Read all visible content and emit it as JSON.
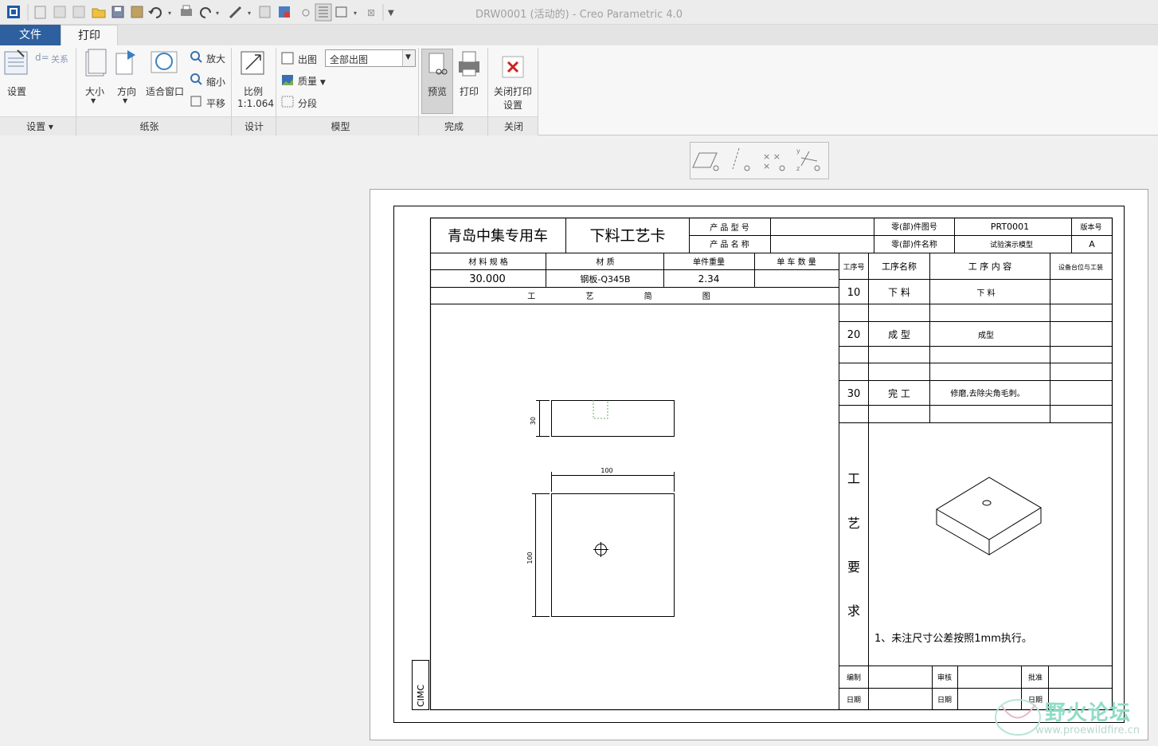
{
  "window": {
    "title": "DRW0001 (活动的) - Creo Parametric 4.0"
  },
  "tabs": {
    "file": "文件",
    "print": "打印"
  },
  "ribbon": {
    "settings": {
      "btn": "设置",
      "relations": "关系",
      "group": "设置"
    },
    "paper": {
      "size": "大小",
      "orient": "方向",
      "fit": "适合窗口",
      "zoom_in": "放大",
      "zoom_out": "缩小",
      "pan": "平移",
      "group": "纸张"
    },
    "design": {
      "scale_label": "比例",
      "scale_value": "1:1.064",
      "group": "设计"
    },
    "model": {
      "output": "出图",
      "output_select": "全部出图",
      "quality": "质量",
      "segment": "分段",
      "group": "模型"
    },
    "finish": {
      "preview": "预览",
      "print": "打印",
      "group": "完成"
    },
    "close": {
      "label1": "关闭打印",
      "label2": "设置",
      "group": "关闭"
    }
  },
  "drawing": {
    "company": "青岛中集专用车",
    "card_title": "下料工艺卡",
    "product_model_label": "产 品 型 号",
    "product_name_label": "产 品 名 称",
    "part_no_label": "零(部)件图号",
    "part_name_label": "零(部)件名称",
    "part_no": "PRT0001",
    "part_name": "试验演示模型",
    "version_label": "版本号",
    "version": "A",
    "mat_spec_label": "材 料 规 格",
    "material_label": "材    质",
    "unit_weight_label": "单件重量",
    "per_vehicle_label": "单 车 数 量",
    "mat_spec": "30.000",
    "material": "钢板-Q345B",
    "unit_weight": "2.34",
    "sketch_label": "工 艺 简 图",
    "ops_headers": {
      "no": "工序号",
      "name": "工序名称",
      "content": "工 序 内 容",
      "equipment": "设备台位与工装"
    },
    "ops": [
      {
        "no": "10",
        "name": "下 料",
        "content": "下 料"
      },
      {
        "no": "20",
        "name": "成 型",
        "content": "成型"
      },
      {
        "no": "30",
        "name": "完 工",
        "content": "修磨,去除尖角毛刺。"
      }
    ],
    "req_label": [
      "工",
      "艺",
      "要",
      "求"
    ],
    "req_text": "1、未注尺寸公差按照1mm执行。",
    "sign": {
      "edit": "编制",
      "review": "审核",
      "approve": "批准",
      "date": "日期"
    },
    "dims": {
      "d30": "30",
      "d100_h": "100",
      "d100_v": "100"
    },
    "logo": "CIMC"
  },
  "watermark": {
    "line1": "野火论坛",
    "line2": "www.proewildfire.cn"
  }
}
